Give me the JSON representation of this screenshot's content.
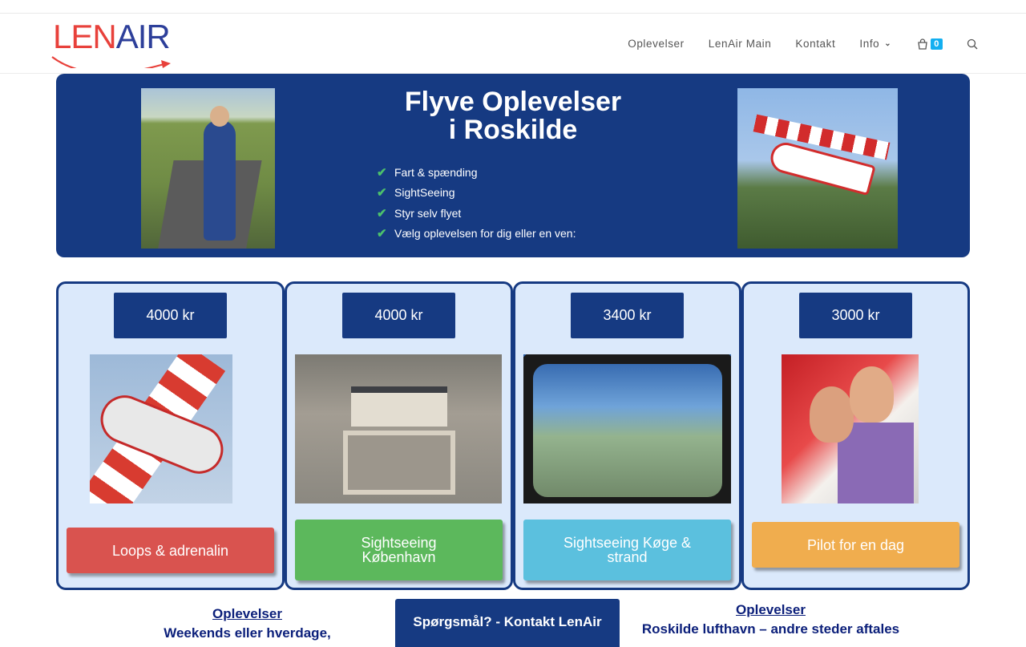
{
  "logo": {
    "len": "LEN",
    "air": "AIR"
  },
  "nav": {
    "items": [
      "Oplevelser",
      "LenAir Main",
      "Kontakt"
    ],
    "info_label": "Info",
    "cart_count": "0"
  },
  "hero": {
    "title_line1": "Flyve Oplevelser",
    "title_line2": "i Roskilde",
    "features": [
      "Fart & spænding",
      "SightSeeing",
      "Styr selv flyet",
      "Vælg oplevelsen for dig eller en ven:"
    ]
  },
  "cards": [
    {
      "price": "4000 kr",
      "cta": "Loops & adrenalin",
      "color": "#d9534f"
    },
    {
      "price": "4000 kr",
      "cta": "Sightseeing København",
      "color": "#5cb85c"
    },
    {
      "price": "3400 kr",
      "cta": "Sightseeing Køge & strand",
      "color": "#5bc0de"
    },
    {
      "price": "3000 kr",
      "cta": "Pilot for en dag",
      "color": "#f0ad4e"
    }
  ],
  "bottom": {
    "left_link": "Oplevelser",
    "left_text": "Weekends eller hverdage,",
    "mid_button": "Spørgsmål? - Kontakt LenAir",
    "right_link": "Oplevelser",
    "right_text": "Roskilde lufthavn – andre steder aftales"
  },
  "colors": {
    "navy": "#163a82",
    "card_bg": "#dbe9fb",
    "check": "#4cc16c",
    "cart_badge": "#13aff0"
  },
  "icons": [
    "check-icon",
    "cart-icon",
    "search-icon",
    "chevron-down-icon"
  ]
}
